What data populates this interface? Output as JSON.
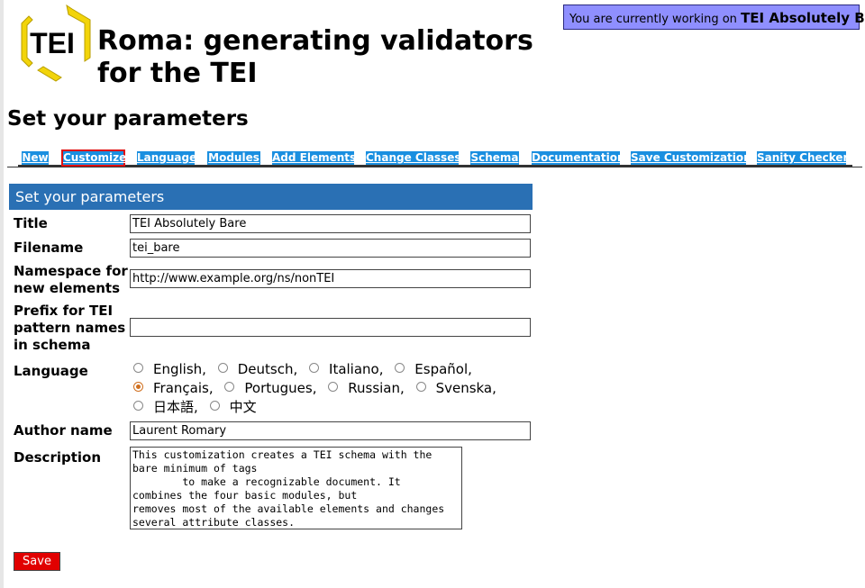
{
  "header": {
    "logo_text": "TEI",
    "title": "Roma: generating validators for the TEI",
    "status_prefix": "You are currently working on",
    "status_project": "TEI Absolutely Bare"
  },
  "page_title": "Set your parameters",
  "tabs": [
    {
      "label": "New",
      "active": false
    },
    {
      "label": "Customize",
      "active": true
    },
    {
      "label": "Language",
      "active": false
    },
    {
      "label": "Modules",
      "active": false
    },
    {
      "label": "Add Elements",
      "active": false
    },
    {
      "label": "Change Classes",
      "active": false
    },
    {
      "label": "Schema",
      "active": false
    },
    {
      "label": "Documentation",
      "active": false
    },
    {
      "label": "Save Customization",
      "active": false
    },
    {
      "label": "Sanity Checker",
      "active": false
    }
  ],
  "form": {
    "header": "Set your parameters",
    "title_label": "Title",
    "title_value": "TEI Absolutely Bare",
    "filename_label": "Filename",
    "filename_value": "tei_bare",
    "namespace_label_1": "Namespace for",
    "namespace_label_2": "new elements",
    "namespace_value": "http://www.example.org/ns/nonTEI",
    "prefix_label_1": "Prefix for TEI",
    "prefix_label_2": "pattern names",
    "prefix_label_3": "in schema",
    "prefix_value": "",
    "language_label": "Language",
    "languages": [
      {
        "label": "English,",
        "selected": false
      },
      {
        "label": "Deutsch,",
        "selected": false
      },
      {
        "label": "Italiano,",
        "selected": false
      },
      {
        "label": "Español,",
        "selected": false
      },
      {
        "label": "Français,",
        "selected": true
      },
      {
        "label": "Portugues,",
        "selected": false
      },
      {
        "label": "Russian,",
        "selected": false
      },
      {
        "label": "Svenska,",
        "selected": false
      },
      {
        "label": "日本語,",
        "selected": false
      },
      {
        "label": "中文",
        "selected": false
      }
    ],
    "author_label": "Author name",
    "author_value": "Laurent Romary",
    "description_label": "Description",
    "description_value": "This customization creates a TEI schema with the\nbare minimum of tags\n        to make a recognizable document. It\ncombines the four basic modules, but\nremoves most of the available elements and changes\nseveral attribute classes.",
    "save_label": "Save"
  },
  "colors": {
    "tab_bg": "#1a8fe0",
    "active_tab_border": "#e01010",
    "form_header_bg": "#2a70b4",
    "status_bg": "#8f8fff",
    "save_bg": "#e10000",
    "logo_yellow": "#f2d40a"
  }
}
